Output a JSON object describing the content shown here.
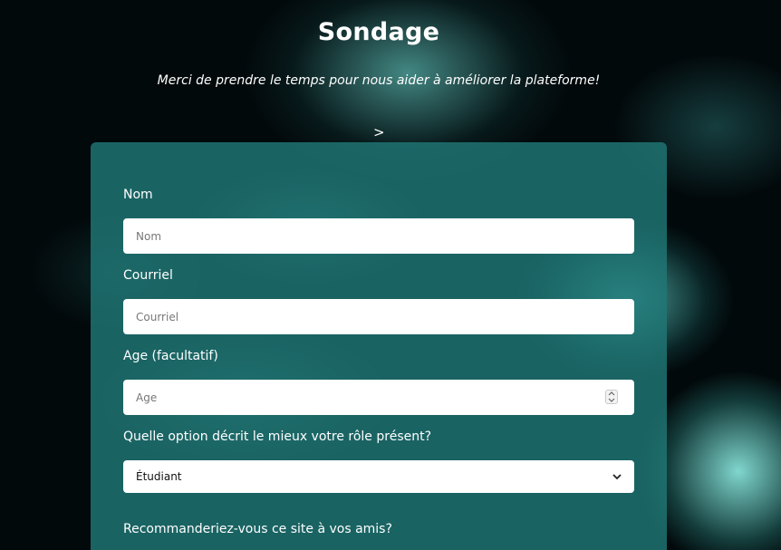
{
  "header": {
    "title": "Sondage",
    "subtitle": "Merci de prendre le temps pour nous aider à améliorer la plateforme!",
    "arrow": ">"
  },
  "form": {
    "name": {
      "label": "Nom",
      "placeholder": "Nom",
      "value": ""
    },
    "email": {
      "label": "Courriel",
      "placeholder": "Courriel",
      "value": ""
    },
    "age": {
      "label": "Age (facultatif)",
      "placeholder": "Age",
      "value": ""
    },
    "role": {
      "label": "Quelle option décrit le mieux votre rôle présent?",
      "selected": "Étudiant"
    },
    "recommend": {
      "label": "Recommanderiez-vous ce site à vos amis?"
    }
  },
  "icons": {
    "spinner": "number-spinner-icon",
    "dropdown": "chevron-down-icon"
  },
  "colors": {
    "card_background": "#207876",
    "text": "#ffffff",
    "field_background": "#ffffff"
  }
}
